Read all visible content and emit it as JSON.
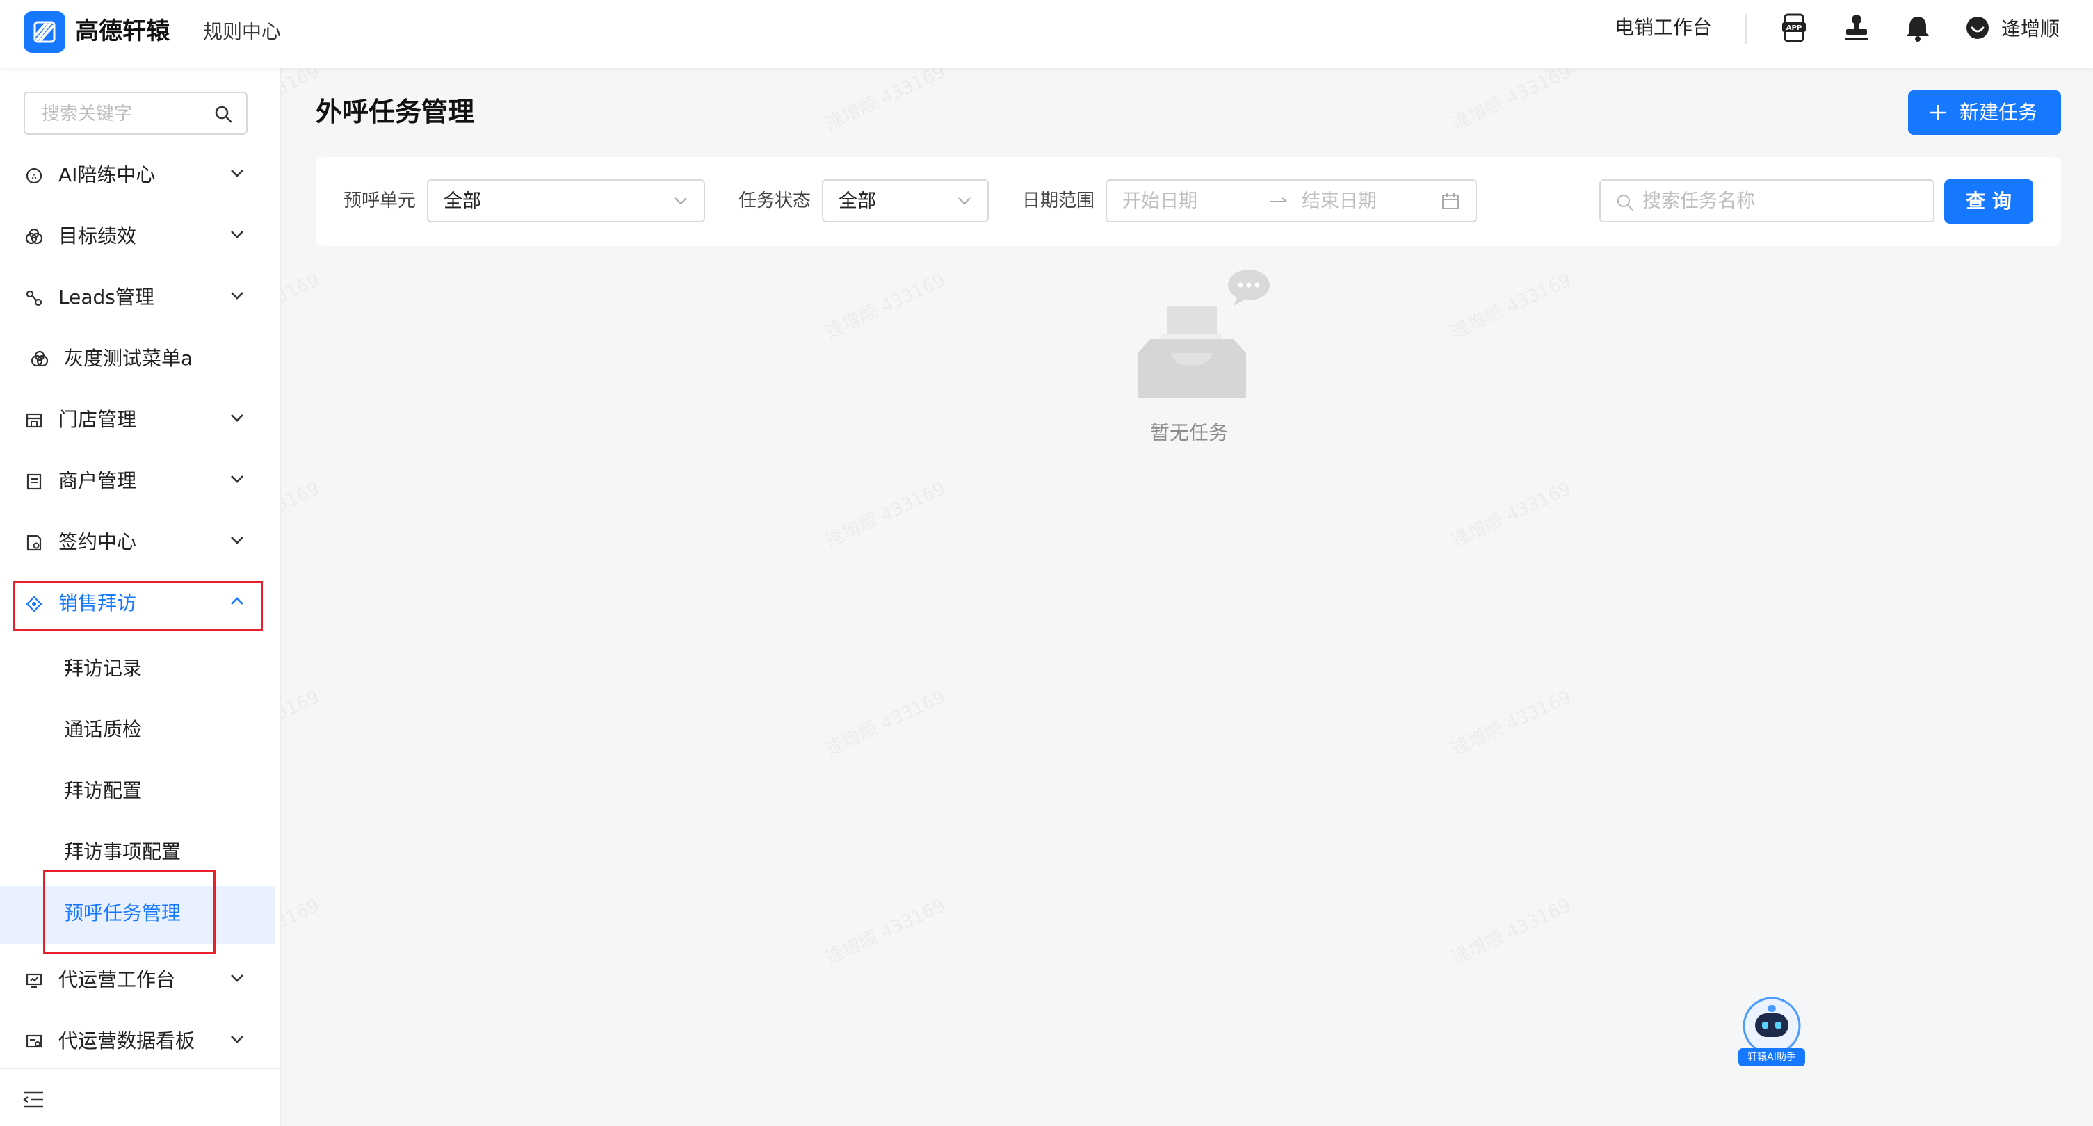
{
  "header": {
    "brand": "高德轩辕",
    "subtitle": "规则中心",
    "workspace_link": "电销工作台",
    "user_name": "逄增顺",
    "icons": [
      "app-icon",
      "stamp-icon",
      "bell-icon",
      "user-avatar-icon"
    ]
  },
  "sidebar": {
    "search_placeholder": "搜索关键字",
    "items": [
      {
        "label": "AI陪练中心",
        "icon": "ai-icon"
      },
      {
        "label": "目标绩效",
        "icon": "target-icon"
      },
      {
        "label": "Leads管理",
        "icon": "leads-icon"
      },
      {
        "label": "灰度测试菜单a",
        "icon": "gray-test-icon"
      },
      {
        "label": "门店管理",
        "icon": "store-icon"
      },
      {
        "label": "商户管理",
        "icon": "merchant-icon"
      },
      {
        "label": "签约中心",
        "icon": "contract-icon"
      },
      {
        "label": "销售拜访",
        "icon": "visit-icon"
      }
    ],
    "sub_items": [
      {
        "label": "拜访记录"
      },
      {
        "label": "通话质检"
      },
      {
        "label": "拜访配置"
      },
      {
        "label": "拜访事项配置"
      },
      {
        "label": "预呼任务管理"
      }
    ],
    "more_items": [
      {
        "label": "代运营工作台",
        "icon": "ops-workbench-icon"
      },
      {
        "label": "代运营数据看板",
        "icon": "ops-dashboard-icon"
      }
    ]
  },
  "main": {
    "title": "外呼任务管理",
    "new_task_label": "新建任务",
    "filters": {
      "unit_label": "预呼单元",
      "unit_value": "全部",
      "status_label": "任务状态",
      "status_value": "全部",
      "date_label": "日期范围",
      "start_placeholder": "开始日期",
      "end_placeholder": "结束日期",
      "search_placeholder": "搜索任务名称",
      "query_label": "查 询"
    },
    "empty_text": "暂无任务"
  },
  "assistant": {
    "label": "轩辕AI助手"
  },
  "watermark": "逄增顺 433169",
  "colors": {
    "primary": "#1677ff",
    "highlight_border": "#e8202a",
    "selected_bg": "#e9f1ff"
  }
}
